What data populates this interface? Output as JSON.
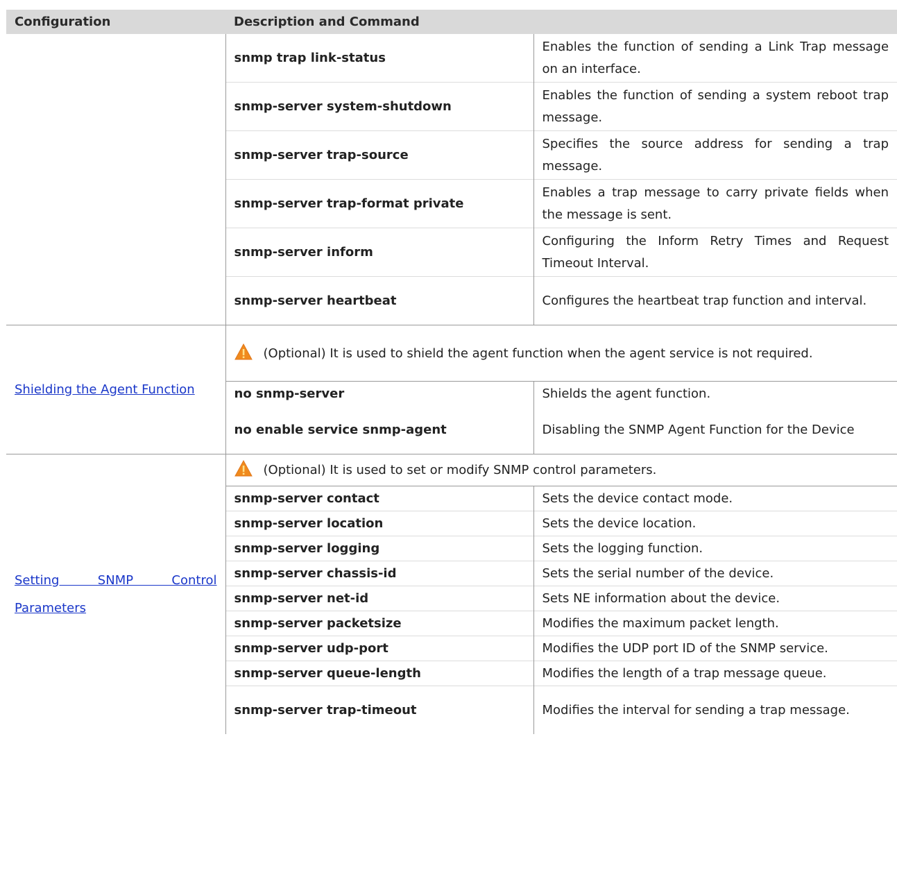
{
  "headers": {
    "configuration": "Configuration",
    "description": "Description and Command"
  },
  "group1": {
    "rows": [
      {
        "command": "snmp trap link-status",
        "description": "Enables the function of sending a Link Trap message on an interface."
      },
      {
        "command": "snmp-server system-shutdown",
        "description": "Enables the function of sending a system reboot trap message."
      },
      {
        "command": "snmp-server trap-source",
        "description": "Specifies the source address for sending a trap message."
      },
      {
        "command": "snmp-server trap-format private",
        "description": "Enables a trap message to carry private fields when the message is sent."
      },
      {
        "command": "snmp-server inform",
        "description": "Configuring the Inform Retry Times and Request Timeout Interval."
      },
      {
        "command": "snmp-server heartbeat",
        "description": "Configures the heartbeat trap function and interval."
      }
    ]
  },
  "group2": {
    "link": "Shielding the Agent Function",
    "note": "(Optional) It is used to shield the agent function when the agent service is not required.",
    "rows": [
      {
        "command": "no snmp-server",
        "description": "Shields the agent function."
      },
      {
        "command": "no enable service snmp-agent",
        "description": "Disabling the SNMP Agent Function for the Device"
      }
    ]
  },
  "group3": {
    "link": "Setting SNMP Control Parameters",
    "note": "(Optional) It is used to set or modify SNMP control parameters.",
    "rows": [
      {
        "command": "snmp-server contact",
        "description": "Sets the device contact mode."
      },
      {
        "command": "snmp-server location",
        "description": "Sets the device location."
      },
      {
        "command": "snmp-server logging",
        "description": "Sets the logging function."
      },
      {
        "command": "snmp-server chassis-id",
        "description": "Sets the serial number of the device."
      },
      {
        "command": "snmp-server net-id",
        "description": "Sets NE information about the device."
      },
      {
        "command": "snmp-server packetsize",
        "description": "Modifies the maximum packet length."
      },
      {
        "command": "snmp-server udp-port",
        "description": "Modifies the UDP port ID of the SNMP service."
      },
      {
        "command": "snmp-server queue-length",
        "description": "Modifies the length of a trap message queue."
      },
      {
        "command": "snmp-server trap-timeout",
        "description": "Modifies the interval for sending a trap message."
      }
    ]
  },
  "icons": {
    "warning": "warning-triangle-icon"
  },
  "colors": {
    "header_bg": "#d9d9d9",
    "link": "#1a37c9",
    "warning_orange": "#f08a1d"
  }
}
